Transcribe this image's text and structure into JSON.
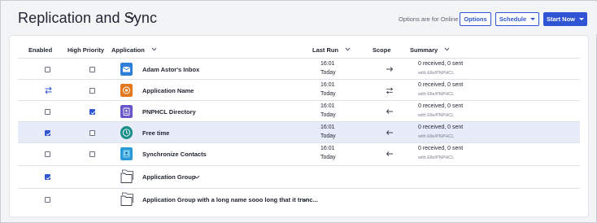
{
  "header": {
    "title": "Replication and Sync",
    "options_note": "Options are for Online",
    "options_label": "Options",
    "schedule_label": "Schedule",
    "start_label": "Start Now"
  },
  "columns": {
    "enabled": "Enabled",
    "high_priority": "High Priority",
    "application": "Application",
    "last_run": "Last Run",
    "scope": "Scope",
    "summary": "Summary"
  },
  "rows": [
    {
      "name": "Adam Astor's Inbox",
      "enabled_state": "unchecked",
      "priority_checked": false,
      "icon": "mail-icon",
      "icon_color": "#2f7fd8",
      "time": "16:01",
      "day": "Today",
      "scope": "right-arrow",
      "summary": "0 received, 0 sent",
      "summary_sub": "with Elle/PNPHCL",
      "selected": false
    },
    {
      "name": "Application Name",
      "enabled_state": "sync",
      "priority_checked": false,
      "icon": "target-icon",
      "icon_color": "#e3781e",
      "time": "16:01",
      "day": "Today",
      "scope": "bidirectional",
      "summary": "0 received, 0 sent",
      "summary_sub": "with Elle/PNPHCL",
      "selected": false
    },
    {
      "name": "PNPHCL Directory",
      "enabled_state": "unchecked",
      "priority_checked": true,
      "icon": "directory-icon",
      "icon_color": "#6a56c8",
      "time": "16:01",
      "day": "Today",
      "scope": "left-arrow",
      "summary": "0 received, 0 sent",
      "summary_sub": "with Elle/PNPHCL",
      "selected": false
    },
    {
      "name": "Free time",
      "enabled_state": "checked",
      "priority_checked": false,
      "icon": "clock-icon",
      "icon_color": "#1a8f8a",
      "time": "16:01",
      "day": "Today",
      "scope": "left-arrow",
      "summary": "0 received, 0 sent",
      "summary_sub": "with Elle/PNPHCL",
      "selected": true
    },
    {
      "name": "Synchronize Contacts",
      "enabled_state": "unchecked",
      "priority_checked": false,
      "icon": "contacts-icon",
      "icon_color": "#2a9ad8",
      "time": "16:01",
      "day": "Today",
      "scope": "left-arrow",
      "summary": "0 received, 0 sent",
      "summary_sub": "with Elle/PNPHCL",
      "selected": false
    }
  ],
  "groups": [
    {
      "name": "Application Group",
      "enabled_checked": true
    },
    {
      "name": "Application Group with a long name sooo long that it trunc...",
      "enabled_checked": false
    }
  ],
  "colors": {
    "accent": "#2f55d4",
    "selected_row": "#e7ecf8"
  }
}
